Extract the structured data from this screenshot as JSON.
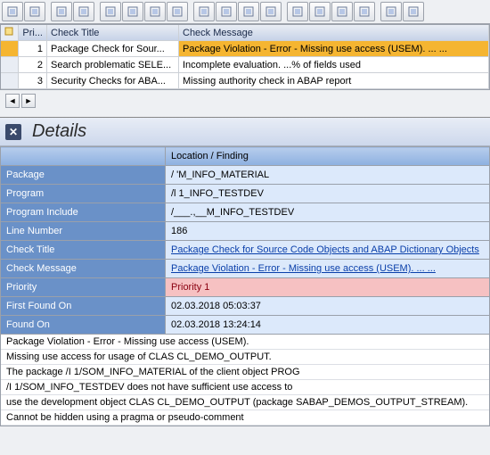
{
  "toolbar_icons": [
    "find",
    "export",
    "import",
    "layout",
    "print",
    "filter",
    "find2",
    "sort",
    "sum",
    "group",
    "sub",
    "sub2",
    "detail",
    "excel",
    "word",
    "tree",
    "variant",
    "config"
  ],
  "grid": {
    "headers": {
      "pri": "Pri...",
      "title": "Check Title",
      "msg": "Check Message"
    },
    "rows": [
      {
        "pri": "1",
        "title": "Package Check for Sour...",
        "msg": "Package Violation - Error - Missing use access (USEM). ... ...",
        "selected": true
      },
      {
        "pri": "2",
        "title": "Search problematic SELE...",
        "msg": "Incomplete evaluation. ...% of fields used",
        "selected": false
      },
      {
        "pri": "3",
        "title": "Security Checks for ABA...",
        "msg": "Missing authority check in ABAP report",
        "selected": false
      }
    ]
  },
  "details": {
    "title": "Details",
    "header_col": "Location / Finding",
    "rows": [
      {
        "label": "Package",
        "value": "/        'M_INFO_MATERIAL"
      },
      {
        "label": "Program",
        "value": "/l        1_INFO_TESTDEV"
      },
      {
        "label": "Program Include",
        "value": "/___.,__M_INFO_TESTDEV"
      },
      {
        "label": "Line Number",
        "value": "186"
      },
      {
        "label": "Check Title",
        "value": "Package Check for Source Code Objects and ABAP Dictionary Objects",
        "link": true
      },
      {
        "label": "Check Message",
        "value": "Package Violation - Error - Missing use access (USEM). ... ...",
        "link": true
      },
      {
        "label": "Priority",
        "value": "Priority 1",
        "priority": true
      },
      {
        "label": "First Found On",
        "value": "02.03.2018 05:03:37"
      },
      {
        "label": "Found On",
        "value": "02.03.2018 13:24:14"
      }
    ],
    "longtext": [
      "Package Violation - Error - Missing use access (USEM).",
      "Missing use access for usage of CLAS CL_DEMO_OUTPUT.",
      "The package /I      1/SOM_INFO_MATERIAL of the client object PROG",
      "   /I      1/SOM_INFO_TESTDEV does not have sufficient use access to",
      "use the development object CLAS CL_DEMO_OUTPUT (package SABAP_DEMOS_OUTPUT_STREAM).",
      "Cannot be hidden using a pragma or pseudo-comment"
    ]
  }
}
